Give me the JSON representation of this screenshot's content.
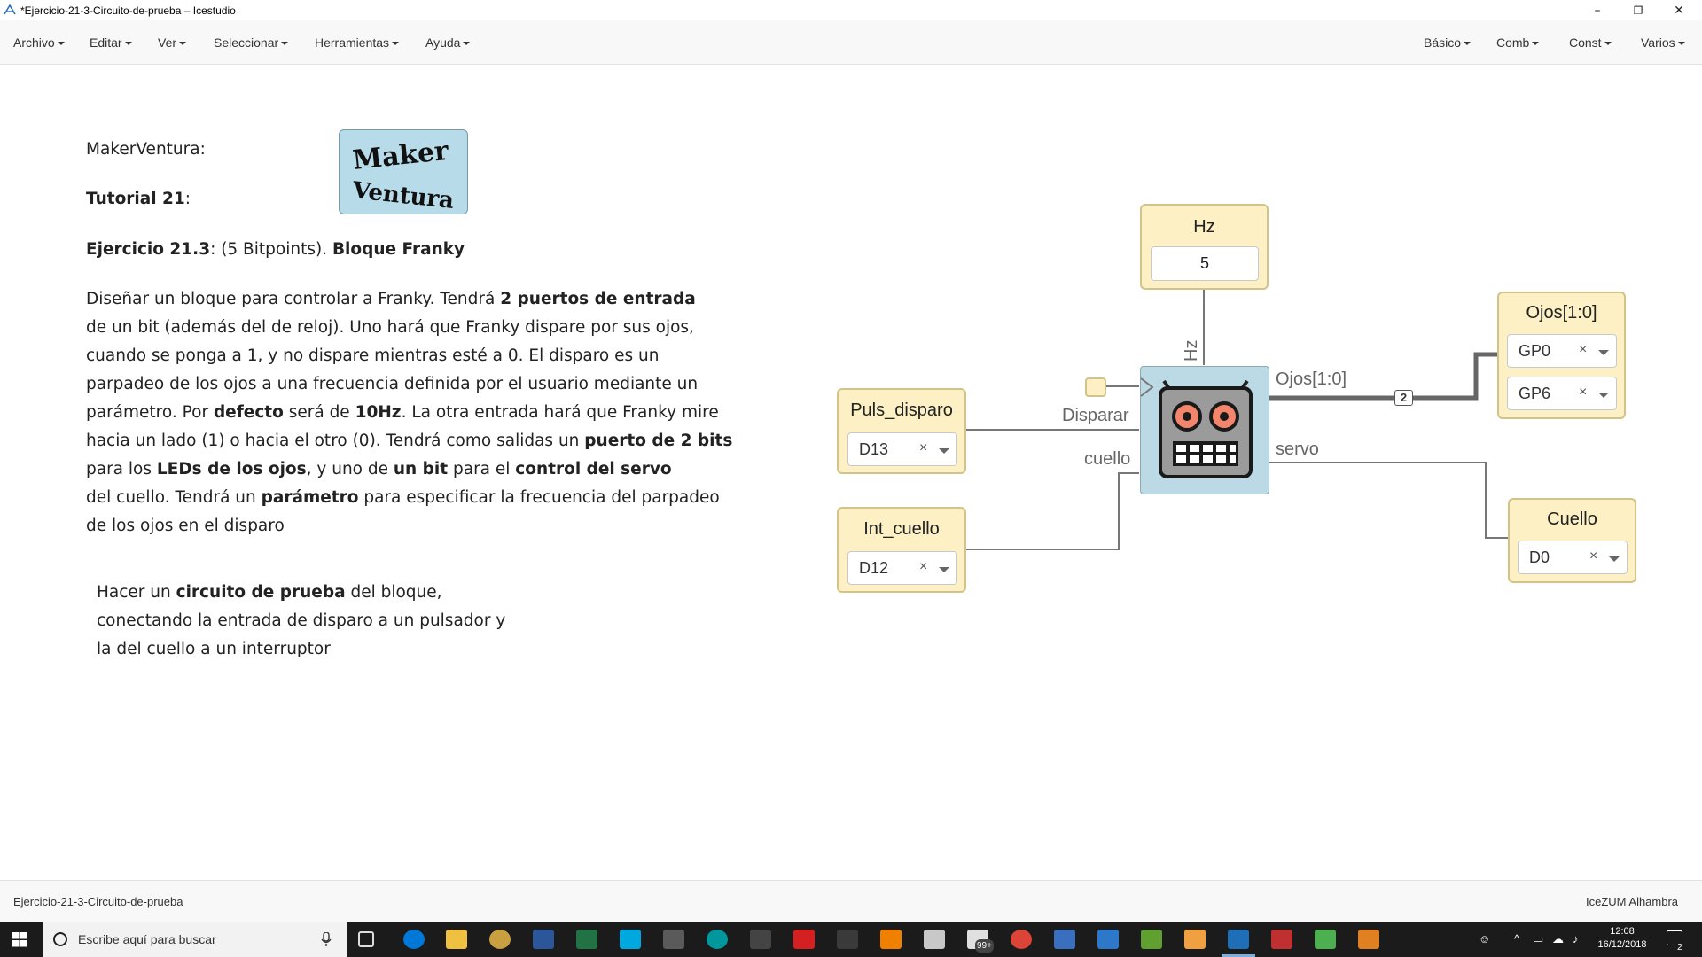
{
  "window": {
    "title": "*Ejercicio-21-3-Circuito-de-prueba – Icestudio",
    "controls": [
      "–",
      "❐",
      "✕"
    ]
  },
  "menu": {
    "left": [
      "Archivo",
      "Editar",
      "Ver",
      "Seleccionar",
      "Herramientas",
      "Ayuda"
    ],
    "right": [
      "Básico",
      "Comb",
      "Const",
      "Varios"
    ]
  },
  "doc": {
    "author_label": "MakerVentura",
    "tutorial_label": "Tutorial 21",
    "exercise_label": "Ejercicio 21.3",
    "exercise_points": "(5 Bitpoints).",
    "exercise_title": "Bloque Franky",
    "logo_line1": "Maker",
    "logo_line2": "Ventura",
    "para": [
      [
        "Diseñar un bloque para controlar a Franky. Tendrá ",
        "2 puertos de entrada",
        ""
      ],
      [
        "de un bit (además del de reloj). Uno hará que Franky dispare por sus ojos,",
        "",
        ""
      ],
      [
        "cuando se ponga a 1, y no dispare mientras esté a 0. El disparo es un",
        "",
        ""
      ],
      [
        "parpadeo de los ojos a una frecuencia definida por el usuario mediante un",
        "",
        ""
      ],
      [
        "parámetro. Por ",
        "defecto",
        " será de ",
        "10Hz",
        ". La otra entrada hará que Franky mire"
      ],
      [
        "hacia un lado (1) o hacia el otro (0). Tendrá como salidas un ",
        "puerto de 2 bits",
        ""
      ],
      [
        "para los ",
        "LEDs de los ojos",
        ", y uno de ",
        "un bit",
        " para el ",
        "control del servo"
      ],
      [
        "del cuello. Tendrá un ",
        "parámetro",
        " para especificar la frecuencia del parpadeo"
      ],
      [
        "de los ojos en el disparo",
        "",
        ""
      ]
    ],
    "para2": [
      [
        "Hacer un ",
        "circuito de prueba",
        " del bloque,"
      ],
      [
        "conectando la entrada de disparo a un pulsador y",
        "",
        ""
      ],
      [
        "la del cuello a un interruptor",
        "",
        ""
      ]
    ]
  },
  "circuit": {
    "param": {
      "label": "Hz",
      "value": "5"
    },
    "inputs": [
      {
        "label": "Puls_disparo",
        "pin": "D13"
      },
      {
        "label": "Int_cuello",
        "pin": "D12"
      }
    ],
    "outputs": [
      {
        "label": "Ojos[1:0]",
        "pins": [
          "GP0",
          "GP6"
        ]
      },
      {
        "label": "Cuello",
        "pins": [
          "D0"
        ]
      }
    ],
    "franky_ports": {
      "param": "Hz",
      "in1": "Disparar",
      "in2": "cuello",
      "out1": "Ojos[1:0]",
      "out2": "servo"
    },
    "bus_width": "2"
  },
  "status": {
    "left": "Ejercicio-21-3-Circuito-de-prueba",
    "right": "IceZUM Alhambra"
  },
  "taskbar": {
    "search_placeholder": "Escribe aquí para buscar",
    "time": "12:08",
    "date": "16/12/2018",
    "notification_count": "2",
    "mail_badge": "99+"
  }
}
